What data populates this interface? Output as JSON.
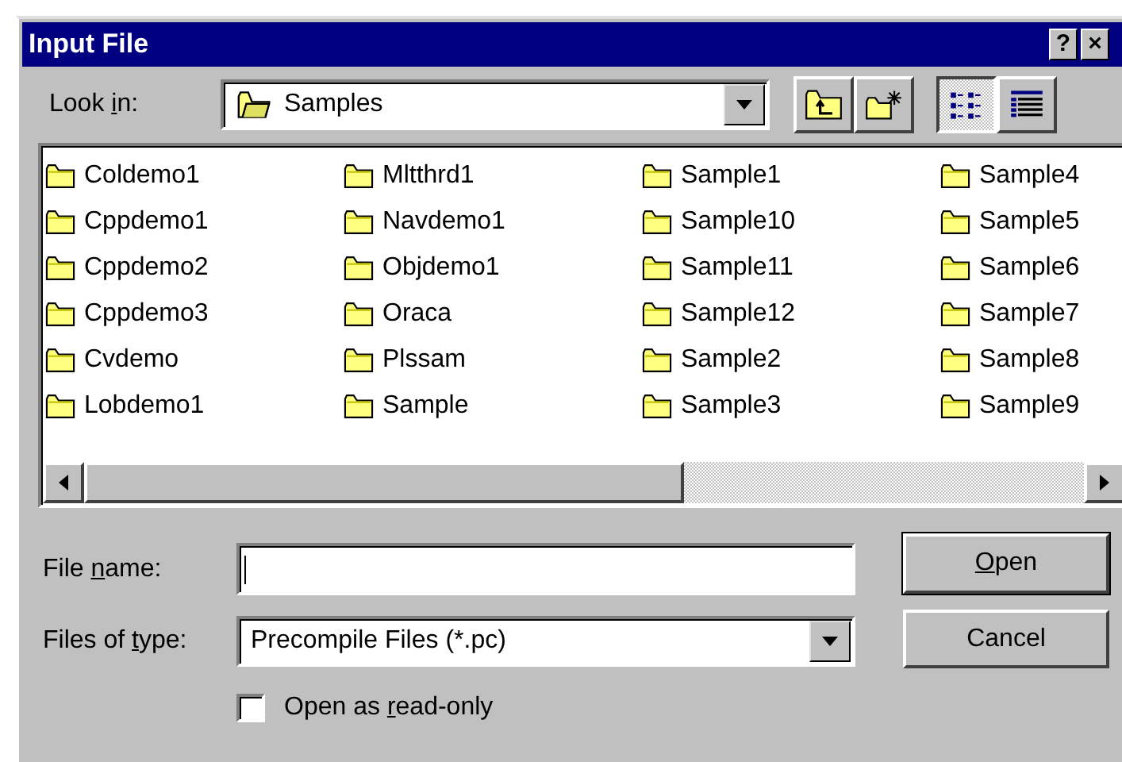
{
  "window": {
    "title": "Input File",
    "help_button": "?",
    "close_button": "×"
  },
  "look_in": {
    "label": {
      "before": "Look ",
      "key": "i",
      "after": "n:"
    },
    "value": "Samples"
  },
  "toolbar": [
    {
      "kind": "up",
      "selected": false
    },
    {
      "kind": "new-folder",
      "selected": false
    },
    {
      "kind": "list",
      "selected": true
    },
    {
      "kind": "details",
      "selected": false
    }
  ],
  "files": [
    {
      "name": "Coldemo1"
    },
    {
      "name": "Cppdemo1"
    },
    {
      "name": "Cppdemo2"
    },
    {
      "name": "Cppdemo3"
    },
    {
      "name": "Cvdemo"
    },
    {
      "name": "Lobdemo1"
    },
    {
      "name": "Mltthrd1"
    },
    {
      "name": "Navdemo1"
    },
    {
      "name": "Objdemo1"
    },
    {
      "name": "Oraca"
    },
    {
      "name": "Plssam"
    },
    {
      "name": "Sample"
    },
    {
      "name": "Sample1"
    },
    {
      "name": "Sample10"
    },
    {
      "name": "Sample11"
    },
    {
      "name": "Sample12"
    },
    {
      "name": "Sample2"
    },
    {
      "name": "Sample3"
    },
    {
      "name": "Sample4"
    },
    {
      "name": "Sample5"
    },
    {
      "name": "Sample6"
    },
    {
      "name": "Sample7"
    },
    {
      "name": "Sample8"
    },
    {
      "name": "Sample9"
    }
  ],
  "file_name": {
    "label": {
      "before": "File ",
      "key": "n",
      "after": "ame:"
    }
  },
  "file_type": {
    "label": {
      "before": "Files of ",
      "key": "t",
      "after": "ype:"
    },
    "value": "Precompile Files (*.pc)"
  },
  "read_only": {
    "label": {
      "before": "Open as ",
      "key": "r",
      "after": "ead-only"
    },
    "checked": false
  },
  "buttons": [
    {
      "kind": "default",
      "label": {
        "key": "O",
        "after": "pen"
      }
    },
    {
      "kind": "normal",
      "label": {
        "before": "Cancel"
      }
    }
  ]
}
